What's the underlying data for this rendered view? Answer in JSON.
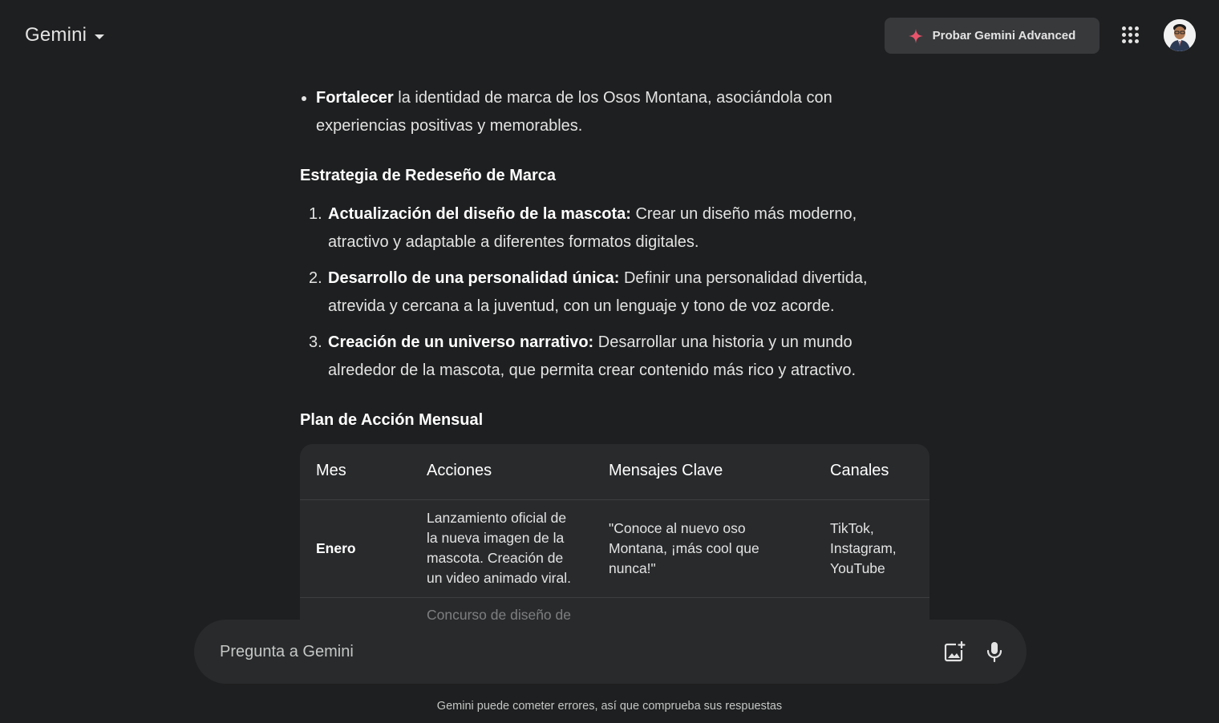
{
  "header": {
    "brand": "Gemini",
    "advanced_button": "Probar Gemini Advanced",
    "sparkle_color": "#e8546b"
  },
  "response": {
    "bullet_bold": "Fortalecer",
    "bullet_line1_rest": " la identidad de marca de los Osos Montana, asociándola con",
    "bullet_line2": "experiencias positivas y memorables.",
    "strategy_heading": "Estrategia de Redeseño de Marca",
    "strategy_items": [
      {
        "num": "1.",
        "bold": "Actualización del diseño de la mascota:",
        "line1": " Crear un diseño más moderno,",
        "line2": "atractivo y adaptable a diferentes formatos digitales."
      },
      {
        "num": "2.",
        "bold": "Desarrollo de una personalidad única:",
        "line1": " Definir una personalidad divertida,",
        "line2": "atrevida y cercana a la juventud, con un lenguaje y tono de voz acorde."
      },
      {
        "num": "3.",
        "bold": "Creación de un universo narrativo:",
        "line1": " Desarrollar una historia y un mundo",
        "line2": "alrededor de la mascota, que permita crear contenido más rico y atractivo."
      }
    ],
    "plan_heading": "Plan de Acción Mensual",
    "table": {
      "headers": [
        "Mes",
        "Acciones",
        "Mensajes Clave",
        "Canales"
      ],
      "rows": [
        {
          "mes": "Enero",
          "acciones": [
            "Lanzamiento oficial de",
            "la nueva imagen de la",
            "mascota. Creación de",
            "un video animado viral."
          ],
          "mensajes": [
            "\"Conoce al nuevo oso",
            "Montana, ¡más cool que",
            "nunca!\""
          ],
          "canales": [
            "TikTok,",
            "Instagram,",
            "YouTube"
          ]
        },
        {
          "mes": "",
          "acciones": [
            "Concurso de diseño de"
          ],
          "mensajes": [],
          "canales": []
        }
      ]
    }
  },
  "input": {
    "placeholder": "Pregunta a Gemini"
  },
  "footer": {
    "disclaimer": "Gemini puede cometer errores, así que comprueba sus respuestas"
  }
}
